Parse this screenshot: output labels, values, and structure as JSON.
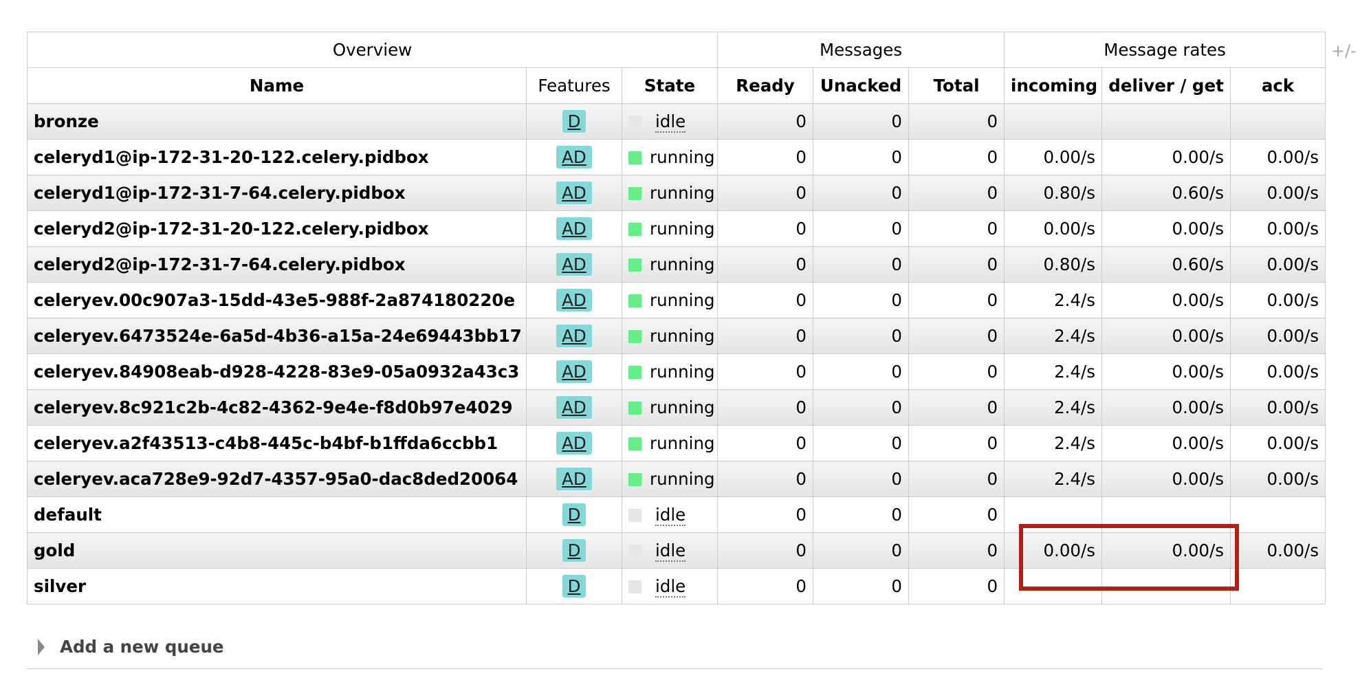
{
  "groups": {
    "overview": "Overview",
    "messages": "Messages",
    "rates": "Message rates"
  },
  "columns": {
    "name": "Name",
    "features": "Features",
    "state": "State",
    "ready": "Ready",
    "unacked": "Unacked",
    "total": "Total",
    "incoming": "incoming",
    "deliver": "deliver / get",
    "ack": "ack"
  },
  "toggle_columns": "+/-",
  "rows": [
    {
      "name": "bronze",
      "features": "D",
      "state": "idle",
      "ready": "0",
      "unacked": "0",
      "total": "0",
      "incoming": "",
      "deliver": "",
      "ack": ""
    },
    {
      "name": "celeryd1@ip-172-31-20-122.celery.pidbox",
      "features": "AD",
      "state": "running",
      "ready": "0",
      "unacked": "0",
      "total": "0",
      "incoming": "0.00/s",
      "deliver": "0.00/s",
      "ack": "0.00/s"
    },
    {
      "name": "celeryd1@ip-172-31-7-64.celery.pidbox",
      "features": "AD",
      "state": "running",
      "ready": "0",
      "unacked": "0",
      "total": "0",
      "incoming": "0.80/s",
      "deliver": "0.60/s",
      "ack": "0.00/s"
    },
    {
      "name": "celeryd2@ip-172-31-20-122.celery.pidbox",
      "features": "AD",
      "state": "running",
      "ready": "0",
      "unacked": "0",
      "total": "0",
      "incoming": "0.00/s",
      "deliver": "0.00/s",
      "ack": "0.00/s"
    },
    {
      "name": "celeryd2@ip-172-31-7-64.celery.pidbox",
      "features": "AD",
      "state": "running",
      "ready": "0",
      "unacked": "0",
      "total": "0",
      "incoming": "0.80/s",
      "deliver": "0.60/s",
      "ack": "0.00/s"
    },
    {
      "name": "celeryev.00c907a3-15dd-43e5-988f-2a874180220e",
      "features": "AD",
      "state": "running",
      "ready": "0",
      "unacked": "0",
      "total": "0",
      "incoming": "2.4/s",
      "deliver": "0.00/s",
      "ack": "0.00/s"
    },
    {
      "name": "celeryev.6473524e-6a5d-4b36-a15a-24e69443bb17",
      "features": "AD",
      "state": "running",
      "ready": "0",
      "unacked": "0",
      "total": "0",
      "incoming": "2.4/s",
      "deliver": "0.00/s",
      "ack": "0.00/s"
    },
    {
      "name": "celeryev.84908eab-d928-4228-83e9-05a0932a43c3",
      "features": "AD",
      "state": "running",
      "ready": "0",
      "unacked": "0",
      "total": "0",
      "incoming": "2.4/s",
      "deliver": "0.00/s",
      "ack": "0.00/s"
    },
    {
      "name": "celeryev.8c921c2b-4c82-4362-9e4e-f8d0b97e4029",
      "features": "AD",
      "state": "running",
      "ready": "0",
      "unacked": "0",
      "total": "0",
      "incoming": "2.4/s",
      "deliver": "0.00/s",
      "ack": "0.00/s"
    },
    {
      "name": "celeryev.a2f43513-c4b8-445c-b4bf-b1ffda6ccbb1",
      "features": "AD",
      "state": "running",
      "ready": "0",
      "unacked": "0",
      "total": "0",
      "incoming": "2.4/s",
      "deliver": "0.00/s",
      "ack": "0.00/s"
    },
    {
      "name": "celeryev.aca728e9-92d7-4357-95a0-dac8ded20064",
      "features": "AD",
      "state": "running",
      "ready": "0",
      "unacked": "0",
      "total": "0",
      "incoming": "2.4/s",
      "deliver": "0.00/s",
      "ack": "0.00/s"
    },
    {
      "name": "default",
      "features": "D",
      "state": "idle",
      "ready": "0",
      "unacked": "0",
      "total": "0",
      "incoming": "",
      "deliver": "",
      "ack": ""
    },
    {
      "name": "gold",
      "features": "D",
      "state": "idle",
      "ready": "0",
      "unacked": "0",
      "total": "0",
      "incoming": "0.00/s",
      "deliver": "0.00/s",
      "ack": "0.00/s"
    },
    {
      "name": "silver",
      "features": "D",
      "state": "idle",
      "ready": "0",
      "unacked": "0",
      "total": "0",
      "incoming": "",
      "deliver": "",
      "ack": ""
    }
  ],
  "add_queue_label": "Add a new queue",
  "colors": {
    "running": "#66ee88",
    "idle": "#e6e6e6",
    "badge": "#86d8d8",
    "highlight": "#b02015"
  }
}
